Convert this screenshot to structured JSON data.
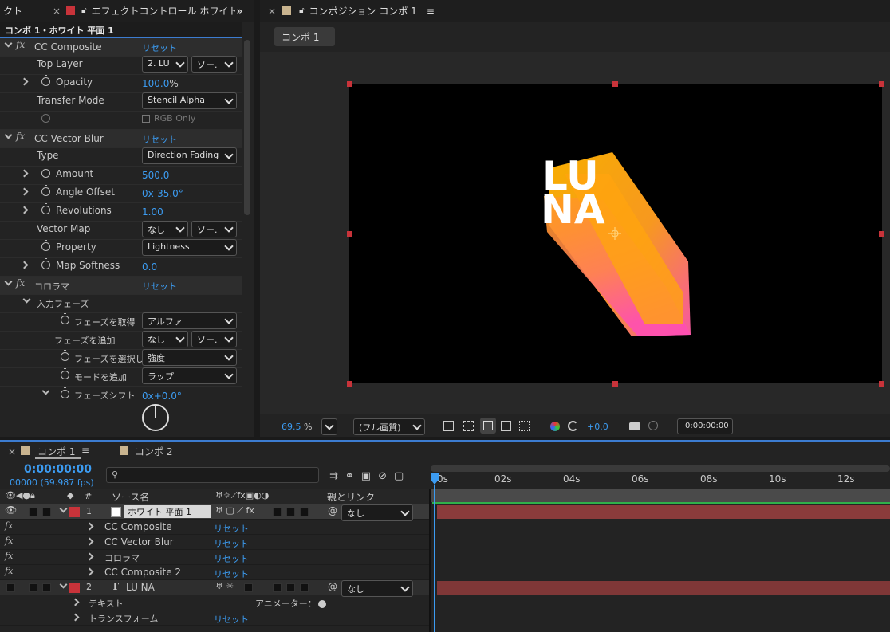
{
  "effect_controls": {
    "tab_prefix": "クト",
    "tab_title": "エフェクトコントロール ホワイト",
    "layer_path": "コンポ 1・ホワイト 平面 1",
    "cc_composite": {
      "name": "CC Composite",
      "reset": "リセット",
      "top_layer_label": "Top Layer",
      "top_layer_value": "2. LU",
      "top_layer_source": "ソー.",
      "opacity_label": "Opacity",
      "opacity_value": "100.0",
      "opacity_unit": "%",
      "transfer_label": "Transfer Mode",
      "transfer_value": "Stencil Alpha",
      "rgb_only": "RGB Only"
    },
    "cc_vector_blur": {
      "name": "CC Vector Blur",
      "reset": "リセット",
      "type_label": "Type",
      "type_value": "Direction Fading",
      "amount_label": "Amount",
      "amount_value": "500.0",
      "angle_label": "Angle Offset",
      "angle_prefix": "0x",
      "angle_value": "-35.0°",
      "rev_label": "Revolutions",
      "rev_value": "1.00",
      "vmap_label": "Vector Map",
      "vmap_value": "なし",
      "vmap_source": "ソー.",
      "property_label": "Property",
      "property_value": "Lightness",
      "softness_label": "Map Softness",
      "softness_value": "0.0"
    },
    "colorama": {
      "name": "コロラマ",
      "reset": "リセット",
      "input_phase": "入力フェーズ",
      "get_phase_label": "フェーズを取得",
      "get_phase_value": "アルファ",
      "add_phase_label": "フェーズを追加",
      "add_phase_value": "なし",
      "add_phase_source": "ソー.",
      "select_phase_label": "フェーズを選択し",
      "select_phase_value": "強度",
      "add_mode_label": "モードを追加",
      "add_mode_value": "ラップ",
      "shift_label": "フェーズシフト",
      "shift_prefix": "0x",
      "shift_value": "+0.0°"
    }
  },
  "composition": {
    "tab_title": "コンポジション コンポ 1",
    "sub_tab": "コンポ 1",
    "artwork_text_1": "LU",
    "artwork_text_2": "NA",
    "footer": {
      "zoom": "69.5",
      "zoom_unit": "%",
      "quality": "(フル画質)",
      "exposure": "+0.0",
      "timecode": "0:00:00:00"
    }
  },
  "timeline": {
    "tab1": "コンポ 1",
    "tab2": "コンポ 2",
    "timecode": "0:00:00:00",
    "frames": "00000 (59.987 fps)",
    "col_source": "ソース名",
    "col_parent": "親とリンク",
    "col_num": "#",
    "ruler": [
      "0s",
      "02s",
      "04s",
      "06s",
      "08s",
      "10s",
      "12s"
    ],
    "layers": [
      {
        "num": "1",
        "name": "ホワイト 平面 1",
        "parent": "なし",
        "effects": [
          {
            "name": "CC Composite",
            "reset": "リセット"
          },
          {
            "name": "CC Vector Blur",
            "reset": "リセット"
          },
          {
            "name": "コロラマ",
            "reset": "リセット"
          },
          {
            "name": "CC Composite 2",
            "reset": "リセット"
          }
        ]
      },
      {
        "num": "2",
        "name": "LU NA",
        "parent": "なし",
        "type_icon": "T",
        "text_group": "テキスト",
        "animator": "アニメーター：",
        "transform": "トランスフォーム",
        "transform_reset": "リセット"
      }
    ]
  },
  "colors": {
    "accent": "#3c9cf2",
    "layer_red": "#c8333a",
    "track_red": "#8a3b3b"
  }
}
